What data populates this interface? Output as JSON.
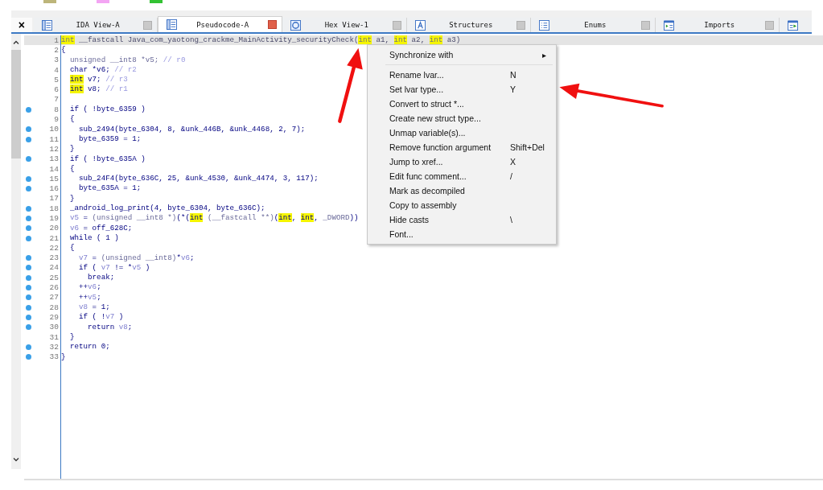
{
  "close_glyph": "×",
  "tabs": [
    {
      "label": "IDA View-A",
      "selected": false
    },
    {
      "label": "Pseudocode-A",
      "selected": true
    },
    {
      "label": "Hex View-1",
      "selected": false
    },
    {
      "label": "Structures",
      "selected": false
    },
    {
      "label": "Enums",
      "selected": false
    },
    {
      "label": "Imports",
      "selected": false
    }
  ],
  "code": [
    {
      "number": "1",
      "dot": false,
      "selected": true,
      "segments": [
        {
          "kind": "type",
          "text": "int"
        },
        {
          "kind": "plain",
          "text": " __fastcall Java_com_yaotong_crackme_MainActivity_securityCheck("
        },
        {
          "kind": "type",
          "text": "int"
        },
        {
          "kind": "plain",
          "text": " a1, "
        },
        {
          "kind": "type",
          "text": "int"
        },
        {
          "kind": "plain",
          "text": " a2, "
        },
        {
          "kind": "type",
          "text": "int"
        },
        {
          "kind": "plain",
          "text": " a3)"
        }
      ]
    },
    {
      "number": "2",
      "dot": false,
      "selected": false,
      "segments": [
        {
          "kind": "plain",
          "text": "{"
        }
      ]
    },
    {
      "number": "3",
      "dot": false,
      "selected": false,
      "segments": [
        {
          "kind": "dim",
          "text": "  unsigned __int8 *v5; "
        },
        {
          "kind": "comment",
          "text": "// r0"
        }
      ]
    },
    {
      "number": "4",
      "dot": false,
      "selected": false,
      "segments": [
        {
          "kind": "plain",
          "text": "  char *v6; "
        },
        {
          "kind": "comment",
          "text": "// r2"
        }
      ]
    },
    {
      "number": "5",
      "dot": false,
      "selected": false,
      "segments": [
        {
          "kind": "type",
          "text": "  int"
        },
        {
          "kind": "plain",
          "text": " v7; "
        },
        {
          "kind": "comment",
          "text": "// r3"
        }
      ]
    },
    {
      "number": "6",
      "dot": false,
      "selected": false,
      "segments": [
        {
          "kind": "type",
          "text": "  int"
        },
        {
          "kind": "plain",
          "text": " v8; "
        },
        {
          "kind": "comment",
          "text": "// r1"
        }
      ]
    },
    {
      "number": "7",
      "dot": false,
      "selected": false
    },
    {
      "number": "8",
      "dot": true,
      "selected": false,
      "segments": [
        {
          "kind": "plain",
          "text": "  if ( !byte_6359 )"
        }
      ]
    },
    {
      "number": "9",
      "dot": false,
      "selected": false,
      "segments": [
        {
          "kind": "plain",
          "text": "  {"
        }
      ]
    },
    {
      "number": "10",
      "dot": true,
      "selected": false,
      "segments": [
        {
          "kind": "plain",
          "text": "    sub_2494(byte_6304, 8, &unk_446B, &unk_4468, 2, 7);"
        }
      ]
    },
    {
      "number": "11",
      "dot": true,
      "selected": false,
      "segments": [
        {
          "kind": "plain",
          "text": "    byte_6359 = 1;"
        }
      ]
    },
    {
      "number": "12",
      "dot": false,
      "selected": false,
      "segments": [
        {
          "kind": "plain",
          "text": "  }"
        }
      ]
    },
    {
      "number": "13",
      "dot": true,
      "selected": false,
      "segments": [
        {
          "kind": "plain",
          "text": "  if ( !byte_635A )"
        }
      ]
    },
    {
      "number": "14",
      "dot": false,
      "selected": false,
      "segments": [
        {
          "kind": "plain",
          "text": "  {"
        }
      ]
    },
    {
      "number": "15",
      "dot": true,
      "selected": false,
      "segments": [
        {
          "kind": "plain",
          "text": "    sub_24F4(byte_636C, 25, &unk_4530, &unk_4474, 3, 117);"
        }
      ]
    },
    {
      "number": "16",
      "dot": true,
      "selected": false,
      "segments": [
        {
          "kind": "plain",
          "text": "    byte_635A = 1;"
        }
      ]
    },
    {
      "number": "17",
      "dot": false,
      "selected": false,
      "segments": [
        {
          "kind": "plain",
          "text": "  }"
        }
      ]
    },
    {
      "number": "18",
      "dot": true,
      "selected": false,
      "segments": [
        {
          "kind": "plain",
          "text": "  _android_log_print(4, byte_6304, byte_636C);"
        }
      ]
    },
    {
      "number": "19",
      "dot": true,
      "selected": false,
      "segments": [
        {
          "kind": "var",
          "text": "  v5"
        },
        {
          "kind": "plain",
          "text": " = "
        },
        {
          "kind": "dim",
          "text": "(unsigned __int8 *)"
        },
        {
          "kind": "plain",
          "text": "(*("
        },
        {
          "kind": "type",
          "text": "int"
        },
        {
          "kind": "dim",
          "text": " (__fastcall **)"
        },
        {
          "kind": "plain",
          "text": "("
        },
        {
          "kind": "type",
          "text": "int"
        },
        {
          "kind": "plain",
          "text": ", "
        },
        {
          "kind": "type",
          "text": "int"
        },
        {
          "kind": "plain",
          "text": ", "
        },
        {
          "kind": "dim",
          "text": "_DWORD"
        },
        {
          "kind": "plain",
          "text": "))"
        }
      ]
    },
    {
      "number": "20",
      "dot": true,
      "selected": false,
      "segments": [
        {
          "kind": "var",
          "text": "  v6"
        },
        {
          "kind": "plain",
          "text": " = off_628C;"
        }
      ]
    },
    {
      "number": "21",
      "dot": true,
      "selected": false,
      "segments": [
        {
          "kind": "plain",
          "text": "  while ( 1 )"
        }
      ]
    },
    {
      "number": "22",
      "dot": false,
      "selected": false,
      "segments": [
        {
          "kind": "plain",
          "text": "  {"
        }
      ]
    },
    {
      "number": "23",
      "dot": true,
      "selected": false,
      "segments": [
        {
          "kind": "var",
          "text": "    v7"
        },
        {
          "kind": "plain",
          "text": " = "
        },
        {
          "kind": "dim",
          "text": "(unsigned __int8)"
        },
        {
          "kind": "plain",
          "text": "*"
        },
        {
          "kind": "var",
          "text": "v6"
        },
        {
          "kind": "plain",
          "text": ";"
        }
      ]
    },
    {
      "number": "24",
      "dot": true,
      "selected": false,
      "segments": [
        {
          "kind": "plain",
          "text": "    if ( "
        },
        {
          "kind": "var",
          "text": "v7"
        },
        {
          "kind": "plain",
          "text": " != *"
        },
        {
          "kind": "var",
          "text": "v5"
        },
        {
          "kind": "plain",
          "text": " )"
        }
      ]
    },
    {
      "number": "25",
      "dot": true,
      "selected": false,
      "segments": [
        {
          "kind": "plain",
          "text": "      break;"
        }
      ]
    },
    {
      "number": "26",
      "dot": true,
      "selected": false,
      "segments": [
        {
          "kind": "plain",
          "text": "    ++"
        },
        {
          "kind": "var",
          "text": "v6"
        },
        {
          "kind": "plain",
          "text": ";"
        }
      ]
    },
    {
      "number": "27",
      "dot": true,
      "selected": false,
      "segments": [
        {
          "kind": "plain",
          "text": "    ++"
        },
        {
          "kind": "var",
          "text": "v5"
        },
        {
          "kind": "plain",
          "text": ";"
        }
      ]
    },
    {
      "number": "28",
      "dot": true,
      "selected": false,
      "segments": [
        {
          "kind": "var",
          "text": "    v8"
        },
        {
          "kind": "plain",
          "text": " = 1;"
        }
      ]
    },
    {
      "number": "29",
      "dot": true,
      "selected": false,
      "segments": [
        {
          "kind": "plain",
          "text": "    if ( !"
        },
        {
          "kind": "var",
          "text": "v7"
        },
        {
          "kind": "plain",
          "text": " )"
        }
      ]
    },
    {
      "number": "30",
      "dot": true,
      "selected": false,
      "segments": [
        {
          "kind": "plain",
          "text": "      return "
        },
        {
          "kind": "var",
          "text": "v8"
        },
        {
          "kind": "plain",
          "text": ";"
        }
      ]
    },
    {
      "number": "31",
      "dot": false,
      "selected": false,
      "segments": [
        {
          "kind": "plain",
          "text": "  }"
        }
      ]
    },
    {
      "number": "32",
      "dot": true,
      "selected": false,
      "segments": [
        {
          "kind": "plain",
          "text": "  return 0;"
        }
      ]
    },
    {
      "number": "33",
      "dot": true,
      "selected": false,
      "segments": [
        {
          "kind": "plain",
          "text": "}"
        }
      ]
    }
  ],
  "context_menu": [
    {
      "kind": "submenu",
      "label": "Synchronize with",
      "arrow": "▸"
    },
    {
      "kind": "separator"
    },
    {
      "kind": "command",
      "label": "Rename lvar...",
      "shortcut": "N"
    },
    {
      "kind": "command",
      "label": "Set lvar type...",
      "shortcut": "Y"
    },
    {
      "kind": "command",
      "label": "Convert to struct *..."
    },
    {
      "kind": "command",
      "label": "Create new struct type..."
    },
    {
      "kind": "command",
      "label": "Unmap variable(s)..."
    },
    {
      "kind": "command",
      "label": "Remove function argument",
      "shortcut": "Shift+Del"
    },
    {
      "kind": "command",
      "label": "Jump to xref...",
      "shortcut": "X"
    },
    {
      "kind": "command",
      "label": "Edit func comment...",
      "shortcut": "/"
    },
    {
      "kind": "command",
      "label": "Mark as decompiled"
    },
    {
      "kind": "command",
      "label": "Copy to assembly"
    },
    {
      "kind": "command",
      "label": "Hide casts",
      "shortcut": "\\"
    },
    {
      "kind": "command",
      "label": "Font..."
    }
  ]
}
